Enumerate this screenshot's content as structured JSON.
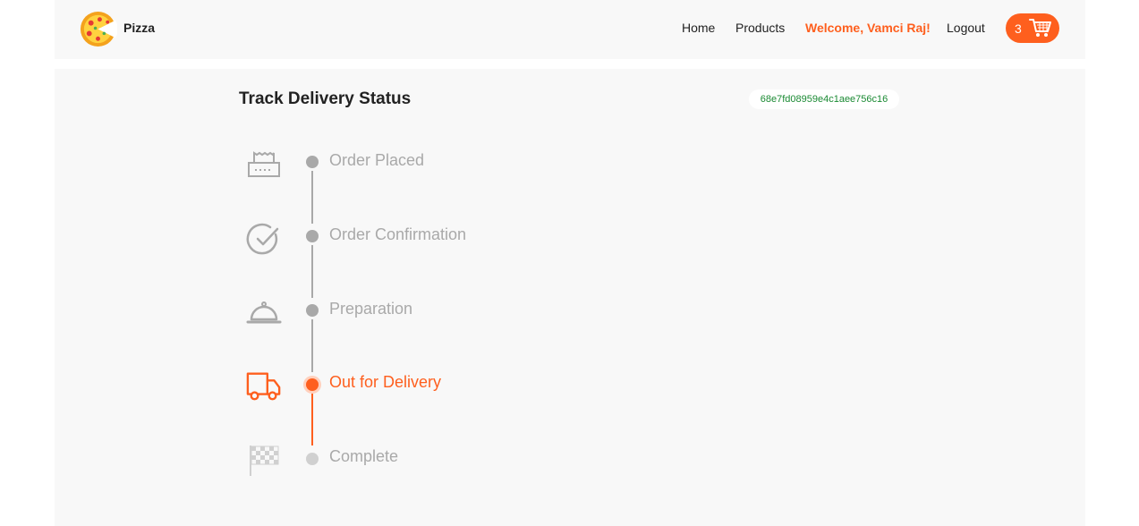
{
  "nav": {
    "brand": "Pizza",
    "home": "Home",
    "products": "Products",
    "welcome": "Welcome, Vamci Raj!",
    "logout": "Logout",
    "cart_count": "3"
  },
  "tracking": {
    "title": "Track Delivery Status",
    "order_id": "68e7fd08959e4c1aee756c16",
    "current_step": 4,
    "steps": [
      {
        "label": "Order Placed",
        "icon": "receipt-icon",
        "state": "done"
      },
      {
        "label": "Order Confirmation",
        "icon": "check-circle-icon",
        "state": "done"
      },
      {
        "label": "Preparation",
        "icon": "cloche-icon",
        "state": "done"
      },
      {
        "label": "Out for Delivery",
        "icon": "delivery-truck-icon",
        "state": "current"
      },
      {
        "label": "Complete",
        "icon": "checkered-flag-icon",
        "state": "pending"
      }
    ]
  },
  "colors": {
    "accent": "#fe5f1e",
    "done": "#a9a9a9",
    "pending": "#d0d0d0",
    "order_id_text": "#1a8a33",
    "background": "#f8f8f8"
  }
}
